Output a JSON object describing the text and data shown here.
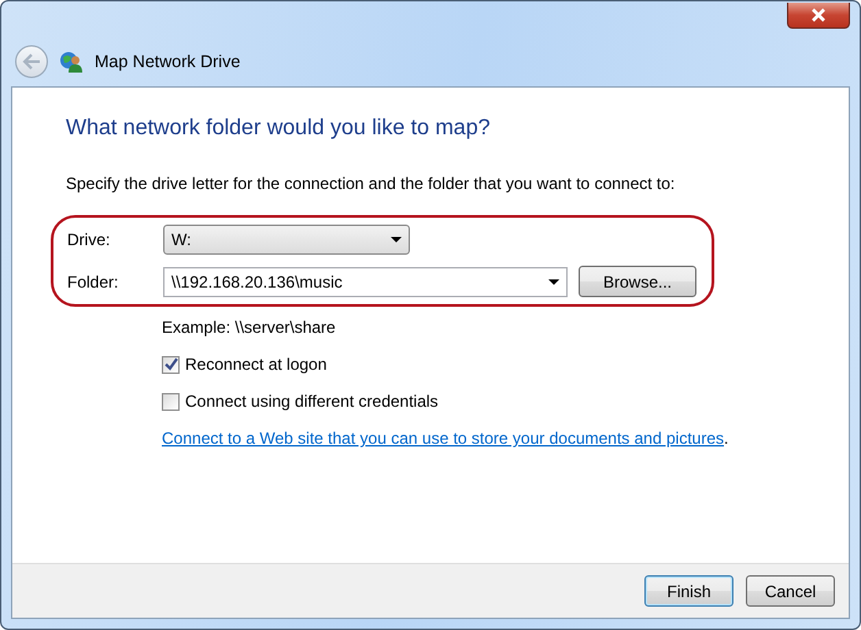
{
  "window": {
    "title": "Map Network Drive"
  },
  "heading": "What network folder would you like to map?",
  "instruction": "Specify the drive letter for the connection and the folder that you want to connect to:",
  "drive": {
    "label": "Drive:",
    "value": "W:"
  },
  "folder": {
    "label": "Folder:",
    "value": "\\\\192.168.20.136\\music"
  },
  "browse_button": "Browse...",
  "example": "Example: \\\\server\\share",
  "options": [
    {
      "label": "Reconnect at logon",
      "checked": true
    },
    {
      "label": "Connect using different credentials",
      "checked": false
    }
  ],
  "link": {
    "text": "Connect to a Web site that you can use to store your documents and pictures",
    "after": "."
  },
  "buttons": [
    {
      "label": "Finish",
      "default": true
    },
    {
      "label": "Cancel",
      "default": false
    }
  ]
}
